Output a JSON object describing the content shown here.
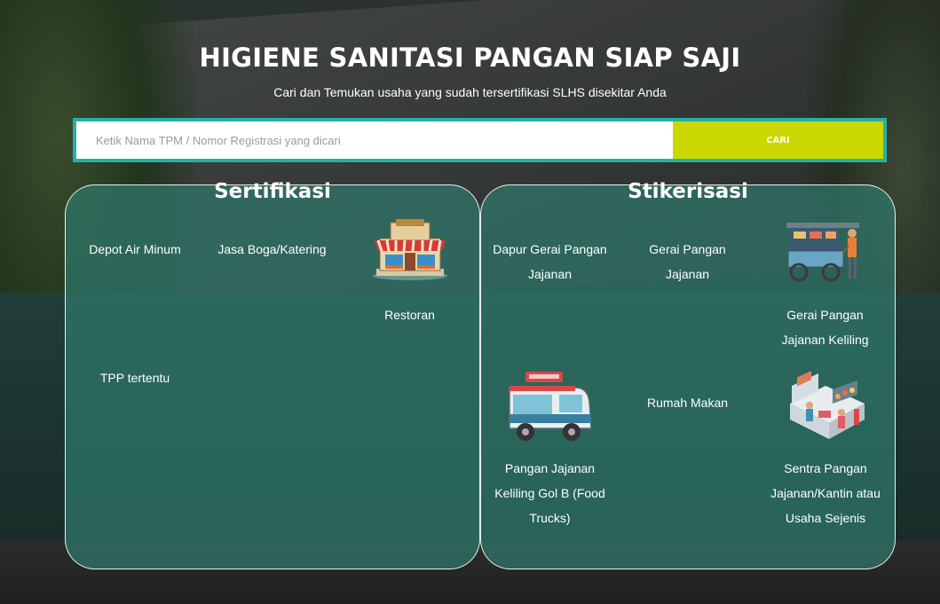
{
  "header": {
    "title": "HIGIENE SANITASI PANGAN SIAP SAJI",
    "subtitle": "Cari dan Temukan usaha yang sudah tersertifikasi SLHS disekitar Anda"
  },
  "search": {
    "placeholder": "Ketik Nama TPM / Nomor Registrasi yang dicari",
    "value": "",
    "button_label": "CARI"
  },
  "colors": {
    "search_border": "#27b0a5",
    "search_button": "#cbd800",
    "panel_fill": "#2f786c"
  },
  "sertifikasi": {
    "title": "Sertifikasi",
    "items": [
      {
        "label": "Depot Air Minum"
      },
      {
        "label": "Jasa Boga/Katering"
      },
      {
        "label": "Restoran",
        "icon": "restaurant-icon"
      },
      {
        "label": "TPP tertentu"
      }
    ]
  },
  "stikerisasi": {
    "title": "Stikerisasi",
    "items": [
      {
        "label": "Dapur Gerai Pangan Jajanan"
      },
      {
        "label": "Gerai Pangan Jajanan"
      },
      {
        "label": "Gerai Pangan Jajanan Keliling",
        "icon": "food-cart-icon"
      },
      {
        "label": "Rumah Makan"
      },
      {
        "label": "Pangan Jajanan Keliling Gol B (Food Trucks)",
        "icon": "food-truck-icon"
      },
      {
        "label": "Sentra Pangan Jajanan/Kantin atau Usaha Sejenis",
        "icon": "food-court-icon"
      }
    ]
  }
}
